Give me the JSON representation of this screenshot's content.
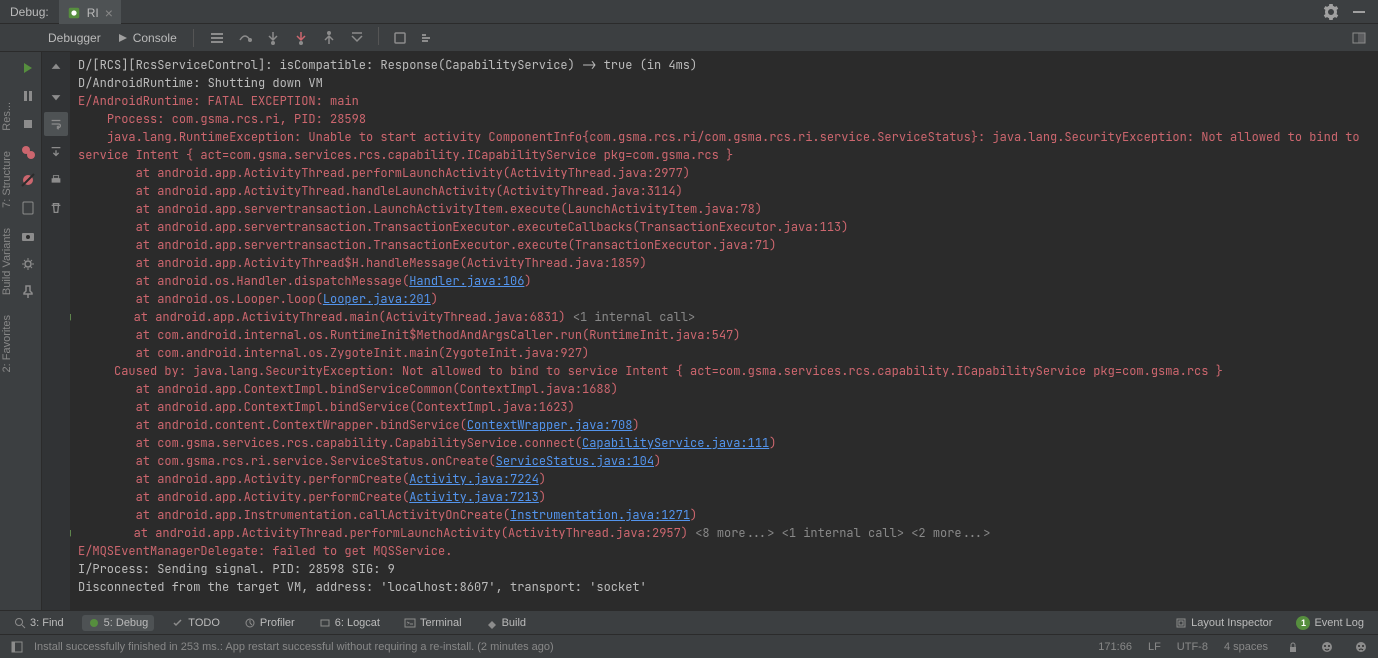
{
  "top": {
    "debug_label": "Debug:",
    "tab_name": "RI"
  },
  "subtoolbar": {
    "debugger": "Debugger",
    "console": "Console"
  },
  "left_tabs": {
    "structure": "7: Structure",
    "build_variants": "Build Variants",
    "favorites": "2: Favorites",
    "res": "Res..."
  },
  "console_lines": [
    {
      "cls": "white",
      "text": "D/[RCS][RcsServiceControl]: isCompatible: Response(CapabilityService) -> true (in 4ms)"
    },
    {
      "cls": "white",
      "text": "D/AndroidRuntime: Shutting down VM"
    },
    {
      "cls": "red",
      "text": "E/AndroidRuntime: FATAL EXCEPTION: main"
    },
    {
      "cls": "red",
      "text": "    Process: com.gsma.rcs.ri, PID: 28598"
    },
    {
      "cls": "red",
      "text": "    java.lang.RuntimeException: Unable to start activity ComponentInfo{com.gsma.rcs.ri/com.gsma.rcs.ri.service.ServiceStatus}: java.lang.SecurityException: Not allowed to bind to service Intent { act=com.gsma.services.rcs.capability.ICapabilityService pkg=com.gsma.rcs }"
    },
    {
      "cls": "red",
      "text": "        at android.app.ActivityThread.performLaunchActivity(ActivityThread.java:2977)"
    },
    {
      "cls": "red",
      "text": "        at android.app.ActivityThread.handleLaunchActivity(ActivityThread.java:3114)"
    },
    {
      "cls": "red",
      "text": "        at android.app.servertransaction.LaunchActivityItem.execute(LaunchActivityItem.java:78)"
    },
    {
      "cls": "red",
      "text": "        at android.app.servertransaction.TransactionExecutor.executeCallbacks(TransactionExecutor.java:113)"
    },
    {
      "cls": "red",
      "text": "        at android.app.servertransaction.TransactionExecutor.execute(TransactionExecutor.java:71)"
    },
    {
      "cls": "red",
      "text": "        at android.app.ActivityThread$H.handleMessage(ActivityThread.java:1859)"
    },
    {
      "cls": "red",
      "text": "        at android.os.Handler.dispatchMessage(",
      "link": "Handler.java:106",
      "after": ")"
    },
    {
      "cls": "red",
      "text": "        at android.os.Looper.loop(",
      "link": "Looper.java:201",
      "after": ")"
    },
    {
      "cls": "red",
      "fold": true,
      "text": "        at android.app.ActivityThread.main(ActivityThread.java:6831) ",
      "folded": "<1 internal call>"
    },
    {
      "cls": "red",
      "text": "        at com.android.internal.os.RuntimeInit$MethodAndArgsCaller.run(RuntimeInit.java:547)"
    },
    {
      "cls": "red",
      "text": "        at com.android.internal.os.ZygoteInit.main(ZygoteInit.java:927)"
    },
    {
      "cls": "red",
      "text": "     Caused by: java.lang.SecurityException: Not allowed to bind to service Intent { act=com.gsma.services.rcs.capability.ICapabilityService pkg=com.gsma.rcs }"
    },
    {
      "cls": "red",
      "text": "        at android.app.ContextImpl.bindServiceCommon(ContextImpl.java:1688)"
    },
    {
      "cls": "red",
      "text": "        at android.app.ContextImpl.bindService(ContextImpl.java:1623)"
    },
    {
      "cls": "red",
      "text": "        at android.content.ContextWrapper.bindService(",
      "link": "ContextWrapper.java:708",
      "after": ")"
    },
    {
      "cls": "red",
      "text": "        at com.gsma.services.rcs.capability.CapabilityService.connect(",
      "link": "CapabilityService.java:111",
      "after": ")"
    },
    {
      "cls": "red",
      "text": "        at com.gsma.rcs.ri.service.ServiceStatus.onCreate(",
      "link": "ServiceStatus.java:104",
      "after": ")"
    },
    {
      "cls": "red",
      "text": "        at android.app.Activity.performCreate(",
      "link": "Activity.java:7224",
      "after": ")"
    },
    {
      "cls": "red",
      "text": "        at android.app.Activity.performCreate(",
      "link": "Activity.java:7213",
      "after": ")"
    },
    {
      "cls": "red",
      "text": "        at android.app.Instrumentation.callActivityOnCreate(",
      "link": "Instrumentation.java:1271",
      "after": ")"
    },
    {
      "cls": "red",
      "fold": true,
      "text": "        at android.app.ActivityThread.performLaunchActivity(ActivityThread.java:2957) ",
      "folded": "<8 more...> <1 internal call> <2 more...>"
    },
    {
      "cls": "red",
      "text": "E/MQSEventManagerDelegate: failed to get MQSService."
    },
    {
      "cls": "white",
      "text": "I/Process: Sending signal. PID: 28598 SIG: 9"
    },
    {
      "cls": "white",
      "text": "Disconnected from the target VM, address: 'localhost:8607', transport: 'socket'"
    }
  ],
  "bottom_tools": {
    "find": "3: Find",
    "debug": "5: Debug",
    "todo": "TODO",
    "profiler": "Profiler",
    "logcat": "6: Logcat",
    "terminal": "Terminal",
    "build": "Build",
    "layout_inspector": "Layout Inspector",
    "event_log": "Event Log",
    "event_badge": "1"
  },
  "status": {
    "message": "Install successfully finished in 253 ms.: App restart successful without requiring a re-install. (2 minutes ago)",
    "pos": "171:66",
    "eol": "LF",
    "encoding": "UTF-8",
    "indent": "4 spaces"
  }
}
